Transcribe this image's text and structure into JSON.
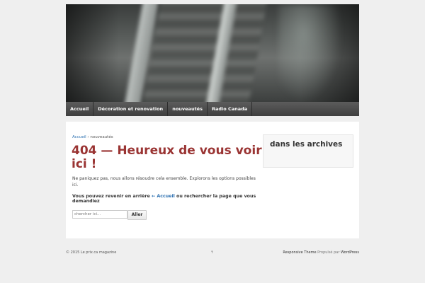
{
  "header": {
    "image_alt": "escalator"
  },
  "nav": {
    "items": [
      "Accueil",
      "Décoration et renovation",
      "nouveautés",
      "Radio Canada"
    ]
  },
  "breadcrumb": {
    "home": "Accueil",
    "separator": "›",
    "current": "nouveautés"
  },
  "main": {
    "title": "404 — Heureux de vous voir ici !",
    "message": "Ne paniquez pas, nous allons résoudre cela ensemble. Explorons les options possibles ici.",
    "back_prefix": "Vous pouvez revenir en arrière",
    "back_link": "← Accueil",
    "back_suffix": "ou rechercher la page que vous demandiez",
    "search_placeholder": "chercher ici...",
    "search_button": "Aller"
  },
  "sidebar": {
    "widget_title": "dans les archives"
  },
  "footer": {
    "copyright": "© 2015 Le prix.ca magazine",
    "scroll_top": "↑",
    "theme_link": "Responsive Theme",
    "powered_text": "Propulsé par",
    "wordpress_link": "WordPress"
  },
  "colors": {
    "title": "#9a3433",
    "link": "#2a6fb0",
    "nav_bg": "#4a4a4a"
  }
}
